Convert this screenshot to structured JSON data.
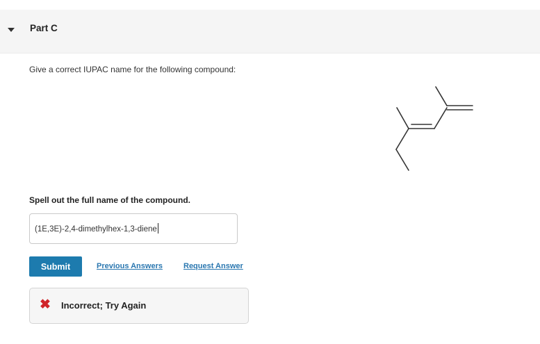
{
  "part": {
    "title": "Part C"
  },
  "question": {
    "prompt": "Give a correct IUPAC name for the following compound:"
  },
  "answer": {
    "label": "Spell out the full name of the compound.",
    "value": "(1E,3E)-2,4-dimethylhex-1,3-diene"
  },
  "actions": {
    "submit": "Submit",
    "previous_answers": "Previous Answers",
    "request_answer": "Request Answer"
  },
  "feedback": {
    "message": "Incorrect; Try Again"
  },
  "colors": {
    "submit_bg": "#1d7bae",
    "link": "#2a77b0",
    "error": "#d0252a",
    "header_bg": "#f5f5f5"
  },
  "icons": {
    "expand": "caret-down-icon",
    "error": "x-mark-icon"
  }
}
